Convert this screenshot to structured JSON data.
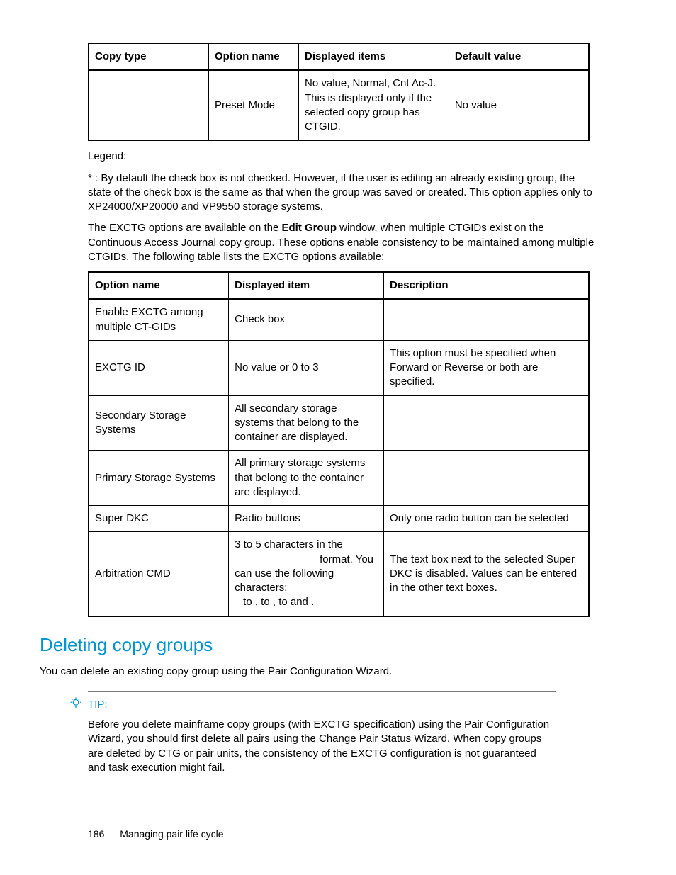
{
  "table1": {
    "headers": [
      "Copy type",
      "Option name",
      "Displayed items",
      "Default value"
    ],
    "row": {
      "copy_type": "",
      "option_name": "Preset Mode",
      "displayed_items": "No value, Normal, Cnt Ac-J. This is displayed only if the selected copy group has CTGID.",
      "default_value": "No value"
    }
  },
  "legend_label": "Legend:",
  "legend_text": "* : By default the check box is not checked. However, if the user is editing an already existing group, the state of the check box is the same as that when the group was saved or created. This option applies only to XP24000/XP20000 and VP9550 storage systems.",
  "intro_a": "The EXCTG options are available on the ",
  "intro_b_bold": "Edit Group",
  "intro_c": " window, when multiple CTGIDs exist on the Continuous Access Journal copy group. These options enable consistency to be maintained among multiple CTGIDs. The following table lists the EXCTG options available:",
  "table2": {
    "headers": [
      "Option name",
      "Displayed item",
      "Description"
    ],
    "rows": [
      {
        "option": "Enable EXCTG among multiple CT-GIDs",
        "displayed": "Check box",
        "desc": ""
      },
      {
        "option": "EXCTG ID",
        "displayed": "No value or 0 to 3",
        "desc": "This option must be specified when Forward or Reverse or both are specified."
      },
      {
        "option": "Secondary Storage Systems",
        "displayed": "All secondary storage systems that belong to the container are displayed.",
        "desc": ""
      },
      {
        "option": "Primary Storage Systems",
        "displayed": "All primary storage systems that belong to the container are displayed.",
        "desc": ""
      },
      {
        "option": "Super DKC",
        "displayed": "Radio buttons",
        "desc": "Only one radio button can be selected"
      },
      {
        "option": "Arbitration CMD",
        "displayed_line1": "3 to 5 characters in the",
        "displayed_line2": "format. You",
        "displayed_line3": "can use the following characters:",
        "displayed_line4": "to , to , to and .",
        "desc": "The text box next to the selected Super DKC is disabled. Values can be entered in the other text boxes."
      }
    ]
  },
  "section_heading": "Deleting copy groups",
  "section_intro": "You can delete an existing copy group using the Pair Configuration Wizard.",
  "tip_label": "TIP:",
  "tip_body": "Before you delete mainframe copy groups (with EXCTG specification) using the Pair Configuration Wizard, you should first delete all pairs using the Change Pair Status Wizard. When copy groups are deleted by CTG or pair units, the consistency of the EXCTG configuration is not guaranteed and task execution might fail.",
  "footer": {
    "page_no": "186",
    "chapter": "Managing pair life cycle"
  }
}
